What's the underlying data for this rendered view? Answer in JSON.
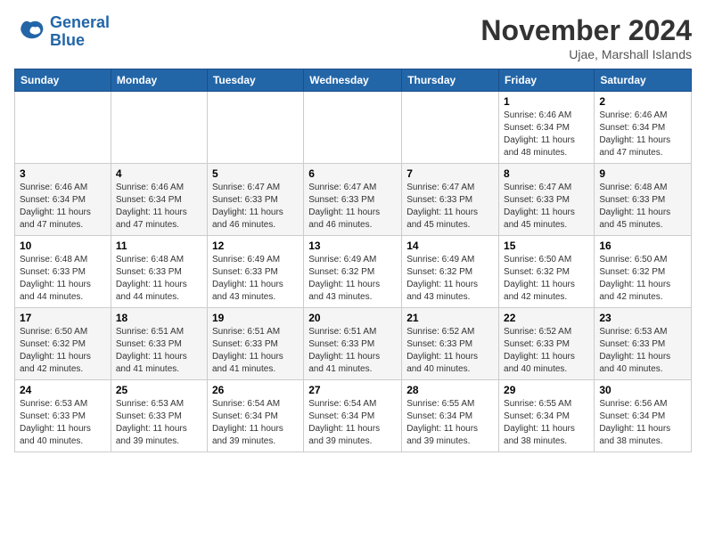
{
  "logo": {
    "line1": "General",
    "line2": "Blue"
  },
  "title": "November 2024",
  "location": "Ujae, Marshall Islands",
  "weekdays": [
    "Sunday",
    "Monday",
    "Tuesday",
    "Wednesday",
    "Thursday",
    "Friday",
    "Saturday"
  ],
  "weeks": [
    [
      {
        "day": "",
        "sunrise": "",
        "sunset": "",
        "daylight": ""
      },
      {
        "day": "",
        "sunrise": "",
        "sunset": "",
        "daylight": ""
      },
      {
        "day": "",
        "sunrise": "",
        "sunset": "",
        "daylight": ""
      },
      {
        "day": "",
        "sunrise": "",
        "sunset": "",
        "daylight": ""
      },
      {
        "day": "",
        "sunrise": "",
        "sunset": "",
        "daylight": ""
      },
      {
        "day": "1",
        "sunrise": "Sunrise: 6:46 AM",
        "sunset": "Sunset: 6:34 PM",
        "daylight": "Daylight: 11 hours and 48 minutes."
      },
      {
        "day": "2",
        "sunrise": "Sunrise: 6:46 AM",
        "sunset": "Sunset: 6:34 PM",
        "daylight": "Daylight: 11 hours and 47 minutes."
      }
    ],
    [
      {
        "day": "3",
        "sunrise": "Sunrise: 6:46 AM",
        "sunset": "Sunset: 6:34 PM",
        "daylight": "Daylight: 11 hours and 47 minutes."
      },
      {
        "day": "4",
        "sunrise": "Sunrise: 6:46 AM",
        "sunset": "Sunset: 6:34 PM",
        "daylight": "Daylight: 11 hours and 47 minutes."
      },
      {
        "day": "5",
        "sunrise": "Sunrise: 6:47 AM",
        "sunset": "Sunset: 6:33 PM",
        "daylight": "Daylight: 11 hours and 46 minutes."
      },
      {
        "day": "6",
        "sunrise": "Sunrise: 6:47 AM",
        "sunset": "Sunset: 6:33 PM",
        "daylight": "Daylight: 11 hours and 46 minutes."
      },
      {
        "day": "7",
        "sunrise": "Sunrise: 6:47 AM",
        "sunset": "Sunset: 6:33 PM",
        "daylight": "Daylight: 11 hours and 45 minutes."
      },
      {
        "day": "8",
        "sunrise": "Sunrise: 6:47 AM",
        "sunset": "Sunset: 6:33 PM",
        "daylight": "Daylight: 11 hours and 45 minutes."
      },
      {
        "day": "9",
        "sunrise": "Sunrise: 6:48 AM",
        "sunset": "Sunset: 6:33 PM",
        "daylight": "Daylight: 11 hours and 45 minutes."
      }
    ],
    [
      {
        "day": "10",
        "sunrise": "Sunrise: 6:48 AM",
        "sunset": "Sunset: 6:33 PM",
        "daylight": "Daylight: 11 hours and 44 minutes."
      },
      {
        "day": "11",
        "sunrise": "Sunrise: 6:48 AM",
        "sunset": "Sunset: 6:33 PM",
        "daylight": "Daylight: 11 hours and 44 minutes."
      },
      {
        "day": "12",
        "sunrise": "Sunrise: 6:49 AM",
        "sunset": "Sunset: 6:33 PM",
        "daylight": "Daylight: 11 hours and 43 minutes."
      },
      {
        "day": "13",
        "sunrise": "Sunrise: 6:49 AM",
        "sunset": "Sunset: 6:32 PM",
        "daylight": "Daylight: 11 hours and 43 minutes."
      },
      {
        "day": "14",
        "sunrise": "Sunrise: 6:49 AM",
        "sunset": "Sunset: 6:32 PM",
        "daylight": "Daylight: 11 hours and 43 minutes."
      },
      {
        "day": "15",
        "sunrise": "Sunrise: 6:50 AM",
        "sunset": "Sunset: 6:32 PM",
        "daylight": "Daylight: 11 hours and 42 minutes."
      },
      {
        "day": "16",
        "sunrise": "Sunrise: 6:50 AM",
        "sunset": "Sunset: 6:32 PM",
        "daylight": "Daylight: 11 hours and 42 minutes."
      }
    ],
    [
      {
        "day": "17",
        "sunrise": "Sunrise: 6:50 AM",
        "sunset": "Sunset: 6:32 PM",
        "daylight": "Daylight: 11 hours and 42 minutes."
      },
      {
        "day": "18",
        "sunrise": "Sunrise: 6:51 AM",
        "sunset": "Sunset: 6:33 PM",
        "daylight": "Daylight: 11 hours and 41 minutes."
      },
      {
        "day": "19",
        "sunrise": "Sunrise: 6:51 AM",
        "sunset": "Sunset: 6:33 PM",
        "daylight": "Daylight: 11 hours and 41 minutes."
      },
      {
        "day": "20",
        "sunrise": "Sunrise: 6:51 AM",
        "sunset": "Sunset: 6:33 PM",
        "daylight": "Daylight: 11 hours and 41 minutes."
      },
      {
        "day": "21",
        "sunrise": "Sunrise: 6:52 AM",
        "sunset": "Sunset: 6:33 PM",
        "daylight": "Daylight: 11 hours and 40 minutes."
      },
      {
        "day": "22",
        "sunrise": "Sunrise: 6:52 AM",
        "sunset": "Sunset: 6:33 PM",
        "daylight": "Daylight: 11 hours and 40 minutes."
      },
      {
        "day": "23",
        "sunrise": "Sunrise: 6:53 AM",
        "sunset": "Sunset: 6:33 PM",
        "daylight": "Daylight: 11 hours and 40 minutes."
      }
    ],
    [
      {
        "day": "24",
        "sunrise": "Sunrise: 6:53 AM",
        "sunset": "Sunset: 6:33 PM",
        "daylight": "Daylight: 11 hours and 40 minutes."
      },
      {
        "day": "25",
        "sunrise": "Sunrise: 6:53 AM",
        "sunset": "Sunset: 6:33 PM",
        "daylight": "Daylight: 11 hours and 39 minutes."
      },
      {
        "day": "26",
        "sunrise": "Sunrise: 6:54 AM",
        "sunset": "Sunset: 6:34 PM",
        "daylight": "Daylight: 11 hours and 39 minutes."
      },
      {
        "day": "27",
        "sunrise": "Sunrise: 6:54 AM",
        "sunset": "Sunset: 6:34 PM",
        "daylight": "Daylight: 11 hours and 39 minutes."
      },
      {
        "day": "28",
        "sunrise": "Sunrise: 6:55 AM",
        "sunset": "Sunset: 6:34 PM",
        "daylight": "Daylight: 11 hours and 39 minutes."
      },
      {
        "day": "29",
        "sunrise": "Sunrise: 6:55 AM",
        "sunset": "Sunset: 6:34 PM",
        "daylight": "Daylight: 11 hours and 38 minutes."
      },
      {
        "day": "30",
        "sunrise": "Sunrise: 6:56 AM",
        "sunset": "Sunset: 6:34 PM",
        "daylight": "Daylight: 11 hours and 38 minutes."
      }
    ]
  ]
}
